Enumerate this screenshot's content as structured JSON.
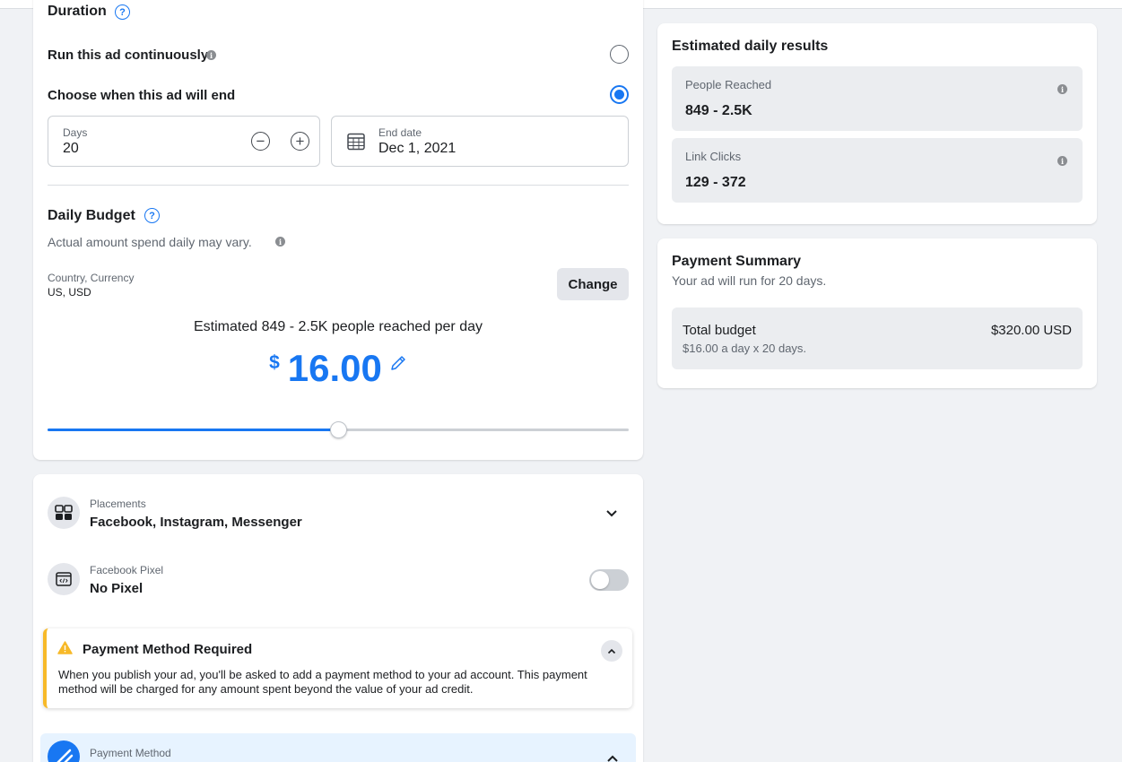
{
  "duration": {
    "title": "Duration",
    "run_continuously_label": "Run this ad continuously",
    "choose_end_label": "Choose when this ad will end",
    "days_label": "Days",
    "days_value": "20",
    "end_date_label": "End date",
    "end_date_value": "Dec 1, 2021"
  },
  "budget": {
    "title": "Daily Budget",
    "subtitle": "Actual amount spend daily may vary.",
    "country_label": "Country, Currency",
    "country_value": "US, USD",
    "change_label": "Change",
    "estimate_text": "Estimated 849 - 2.5K people reached per day",
    "currency_symbol": "$",
    "amount": "16.00",
    "slider_fraction": 0.5
  },
  "placements": {
    "label": "Placements",
    "value": "Facebook, Instagram, Messenger"
  },
  "pixel": {
    "label": "Facebook Pixel",
    "value": "No Pixel",
    "enabled": false
  },
  "payment_alert": {
    "title": "Payment Method Required",
    "body": "When you publish your ad, you'll be asked to add a payment method to your ad account. This payment method will be charged for any amount spent beyond the value of your ad credit."
  },
  "payment_method": {
    "label": "Payment Method"
  },
  "results": {
    "title": "Estimated daily results",
    "people_label": "People Reached",
    "people_value": "849 - 2.5K",
    "clicks_label": "Link Clicks",
    "clicks_value": "129 - 372"
  },
  "summary": {
    "title": "Payment Summary",
    "subtitle": "Your ad will run for 20 days.",
    "total_label": "Total budget",
    "total_value": "$320.00 USD",
    "breakdown": "$16.00 a day x 20 days."
  },
  "colors": {
    "accent": "#1877f2",
    "warning": "#f7b928",
    "background": "#f0f2f5"
  }
}
